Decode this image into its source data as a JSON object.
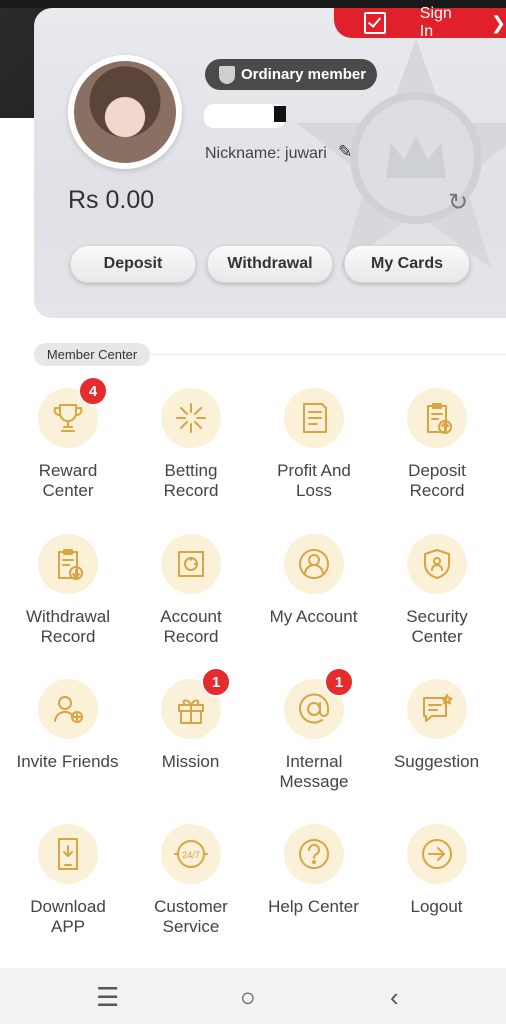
{
  "header": {
    "signin_label": "Sign In",
    "member_level": "Ordinary member",
    "nickname": "Nickname: juwari",
    "balance": "Rs 0.00"
  },
  "actions": {
    "deposit": "Deposit",
    "withdrawal": "Withdrawal",
    "my_cards": "My Cards"
  },
  "member_center": {
    "title": "Member Center",
    "items": [
      {
        "label": "Reward Center",
        "icon": "trophy-icon",
        "badge": "4"
      },
      {
        "label": "Betting Record",
        "icon": "star-burst-icon",
        "badge": ""
      },
      {
        "label": "Profit And Loss",
        "icon": "receipt-icon",
        "badge": ""
      },
      {
        "label": "Deposit Record",
        "icon": "clipboard-upload-icon",
        "badge": ""
      },
      {
        "label": "Withdrawal Record",
        "icon": "clipboard-download-icon",
        "badge": ""
      },
      {
        "label": "Account Record",
        "icon": "safe-icon",
        "badge": ""
      },
      {
        "label": "My Account",
        "icon": "user-circle-icon",
        "badge": ""
      },
      {
        "label": "Security Center",
        "icon": "shield-user-icon",
        "badge": ""
      },
      {
        "label": "Invite Friends",
        "icon": "user-add-icon",
        "badge": ""
      },
      {
        "label": "Mission",
        "icon": "gift-icon",
        "badge": "1"
      },
      {
        "label": "Internal Message",
        "icon": "at-sign-icon",
        "badge": "1"
      },
      {
        "label": "Suggestion",
        "icon": "feedback-icon",
        "badge": ""
      },
      {
        "label": "Download APP",
        "icon": "phone-download-icon",
        "badge": ""
      },
      {
        "label": "Customer Service",
        "icon": "support-24-7-icon",
        "badge": ""
      },
      {
        "label": "Help Center",
        "icon": "question-icon",
        "badge": ""
      },
      {
        "label": "Logout",
        "icon": "logout-icon",
        "badge": ""
      }
    ]
  },
  "colors": {
    "accent_red": "#e0202b",
    "icon_gold": "#d9a441",
    "icon_bg": "#fbf0d8"
  }
}
